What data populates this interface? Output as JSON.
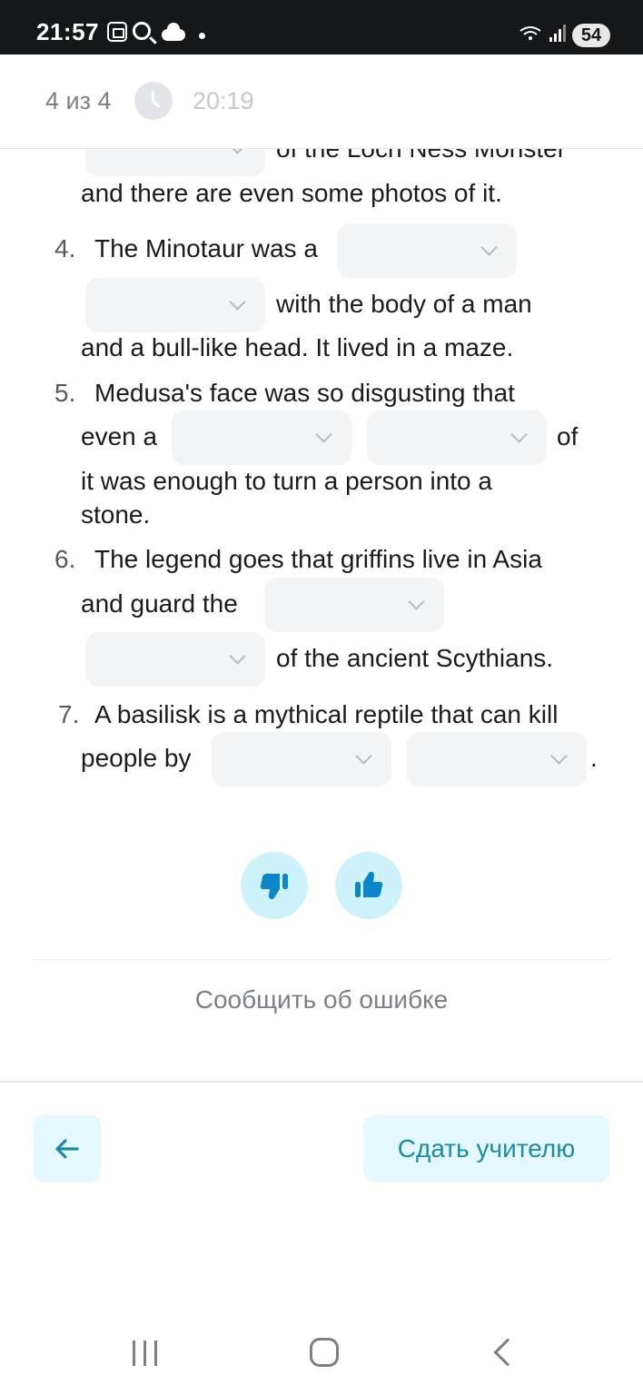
{
  "status_bar": {
    "time": "21:57",
    "battery": "54",
    "wifi_band": "5"
  },
  "header": {
    "counter": "4 из 4",
    "timer": "20:19"
  },
  "questions": {
    "q3": {
      "line_top": "of the Loch Ness Monster",
      "line_bottom": "and there are even some photos of it."
    },
    "q4": {
      "num": "4.",
      "text_a": "The Minotaur was a",
      "text_b": "with the body of a man",
      "text_c": "and a bull-like head. It lived in a maze."
    },
    "q5": {
      "num": "5.",
      "text_a": "Medusa's face was so disgusting that",
      "text_b": "even a",
      "text_c": "of",
      "text_d": "it was enough to turn a person into a",
      "text_e": "stone."
    },
    "q6": {
      "num": "6.",
      "text_a": "The legend goes that griffins live in Asia",
      "text_b": "and guard the",
      "text_c": "of the ancient Scythians."
    },
    "q7": {
      "num": "7.",
      "text_a": "A basilisk is a mythical reptile that can kill",
      "text_b": "people by",
      "text_c": "."
    }
  },
  "feedback": {
    "report_label": "Сообщить об ошибке"
  },
  "footer": {
    "submit_label": "Сдать учителю"
  },
  "colors": {
    "accent": "#1d8ba8",
    "button_bg": "#e3f9fd",
    "feedback_bg": "#cdf2fb",
    "icon": "#0a86c9"
  }
}
